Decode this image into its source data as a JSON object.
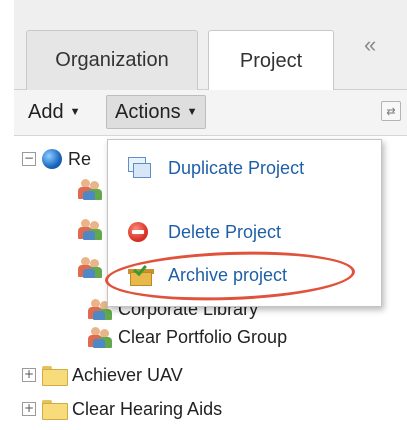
{
  "tabs": [
    {
      "label": "Organization",
      "active": false
    },
    {
      "label": "Project",
      "active": true
    }
  ],
  "collapse_icon": "double-chevron-left-icon",
  "toolbar": {
    "add_label": "Add",
    "actions_label": "Actions",
    "refresh_icon": "refresh-icon"
  },
  "tree": {
    "root": {
      "label": "Re",
      "icon": "globe-icon",
      "expanded": true
    },
    "children": [
      {
        "label": "Corporate Library",
        "icon": "group-icon"
      },
      {
        "label": "Clear Portfolio Group",
        "icon": "group-icon"
      }
    ],
    "folders": [
      {
        "label": "Achiever UAV",
        "icon": "folder-icon",
        "expanded": false
      },
      {
        "label": "Clear Hearing Aids",
        "icon": "folder-icon",
        "expanded": false
      }
    ]
  },
  "actions_menu": {
    "items": [
      {
        "label": "Duplicate Project",
        "icon": "duplicate-icon"
      },
      {
        "label": "Delete Project",
        "icon": "delete-icon"
      },
      {
        "label": "Archive project",
        "icon": "archive-icon",
        "highlighted": true
      }
    ]
  },
  "colors": {
    "menu_text": "#1f5fa8",
    "highlight": "#e0523c",
    "toolbar_bg": "#f4f4f4"
  }
}
